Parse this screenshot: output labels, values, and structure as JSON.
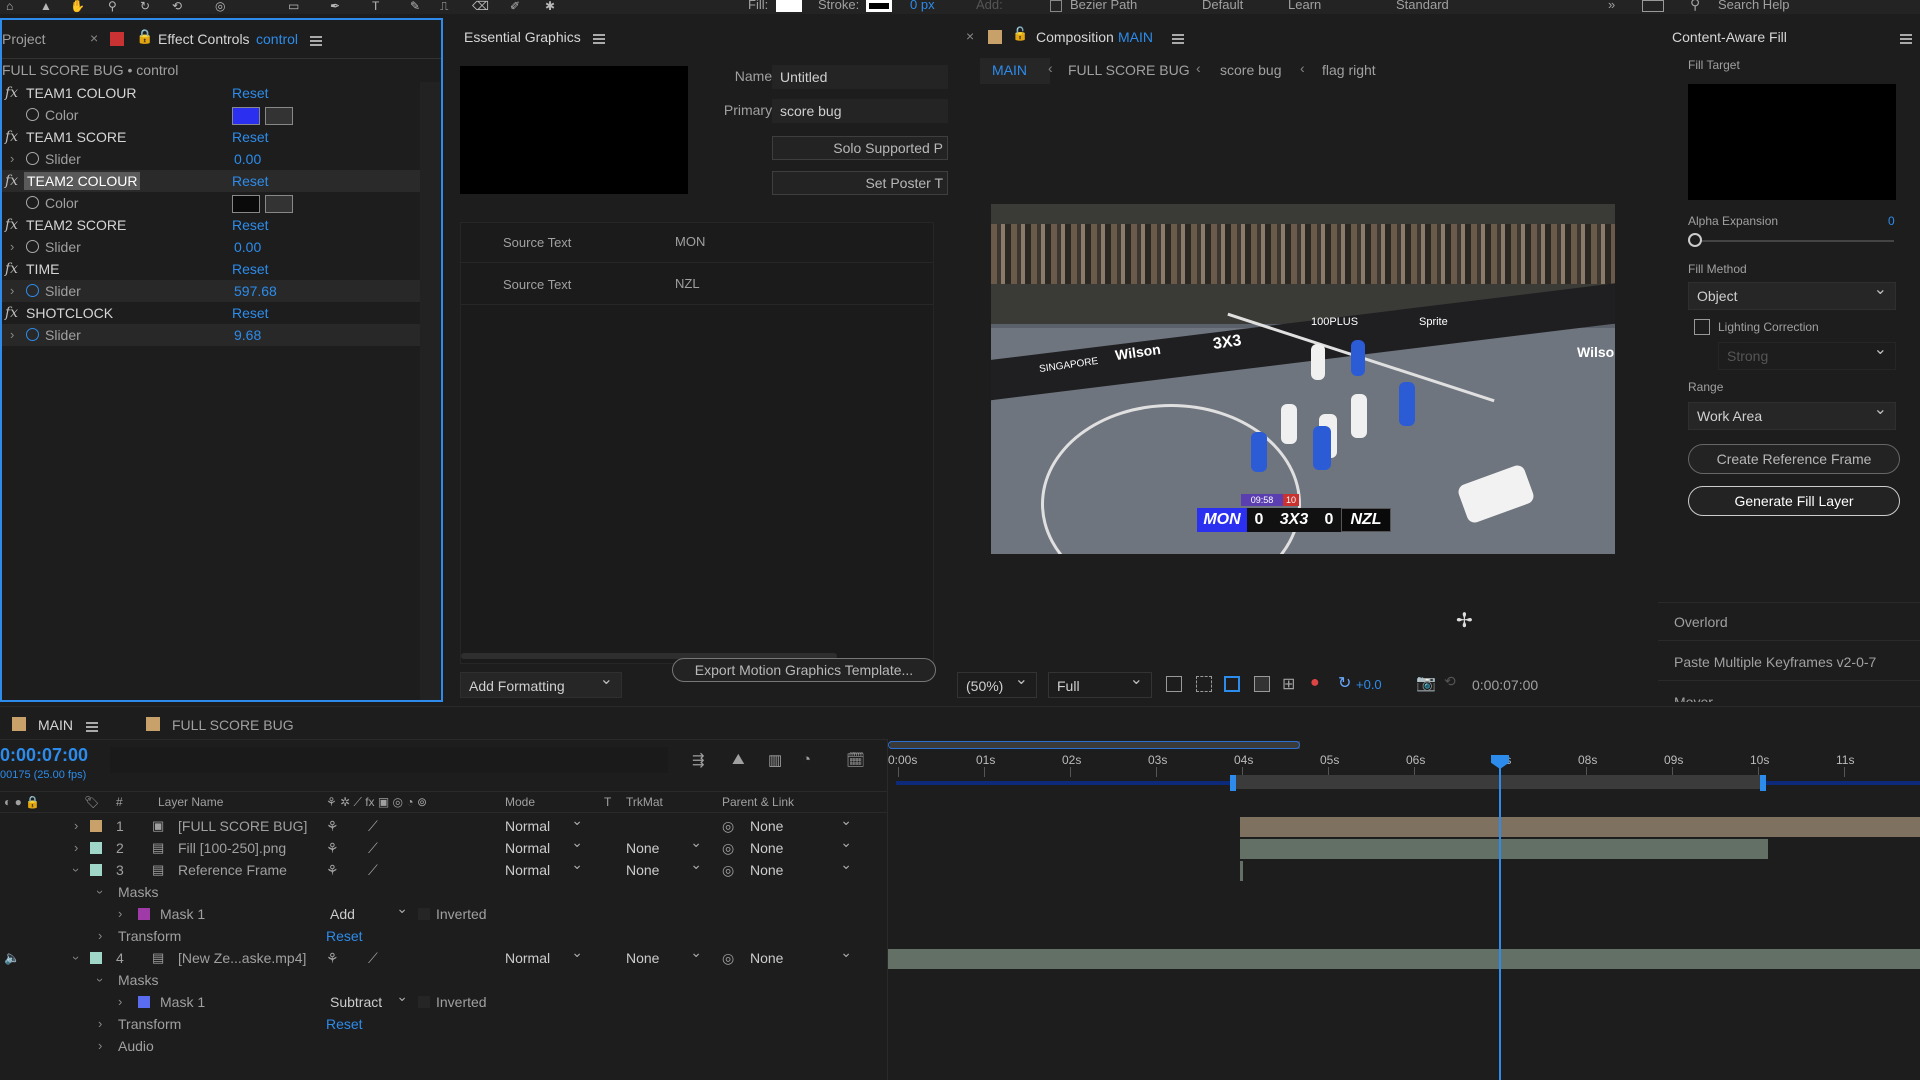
{
  "toolbar": {
    "fill_label": "Fill:",
    "stroke_label": "Stroke:",
    "stroke_px": "0 px",
    "add_label": "Add:",
    "bezier_label": "Bezier Path",
    "workspaces": [
      "Default",
      "Learn",
      "Standard"
    ],
    "search_help": "Search Help"
  },
  "left_panel": {
    "project_tab": "Project",
    "effect_controls_tab": "Effect Controls",
    "effect_controls_target": "control",
    "layer_path": "FULL SCORE BUG • control",
    "effects": [
      {
        "name": "TEAM1 COLOUR",
        "reset": "Reset",
        "prop": "Color",
        "type": "color",
        "color": "#2a2ff0"
      },
      {
        "name": "TEAM1 SCORE",
        "reset": "Reset",
        "prop": "Slider",
        "type": "slider",
        "value": "0.00"
      },
      {
        "name": "TEAM2 COLOUR",
        "reset": "Reset",
        "prop": "Color",
        "type": "color",
        "color": "#0a0a0a"
      },
      {
        "name": "TEAM2 SCORE",
        "reset": "Reset",
        "prop": "Slider",
        "type": "slider",
        "value": "0.00"
      },
      {
        "name": "TIME",
        "reset": "Reset",
        "prop": "Slider",
        "type": "slider",
        "value": "597.68"
      },
      {
        "name": "SHOTCLOCK",
        "reset": "Reset",
        "prop": "Slider",
        "type": "slider",
        "value": "9.68"
      }
    ]
  },
  "essential_graphics": {
    "tab": "Essential Graphics",
    "name_label": "Name:",
    "name_value": "Untitled",
    "primary_label": "Primary:",
    "primary_value": "score bug",
    "solo_button": "Solo Supported P",
    "poster_button": "Set Poster T",
    "properties": [
      {
        "label": "Source Text",
        "value": "MON"
      },
      {
        "label": "Source Text",
        "value": "NZL"
      }
    ],
    "add_formatting": "Add Formatting",
    "export_button": "Export Motion Graphics Template..."
  },
  "composition": {
    "tab_prefix": "Composition",
    "tab_name": "MAIN",
    "breadcrumbs": [
      "MAIN",
      "FULL SCORE BUG",
      "score bug",
      "flag right"
    ],
    "scorebug": {
      "team1": "MON",
      "score1": "0",
      "logo": "3X3",
      "score2": "0",
      "team2": "NZL",
      "clock": "09:58",
      "shotclock": "10"
    },
    "zoom": "(50%)",
    "resolution": "Full",
    "exposure": "+0.0",
    "timecode": "0:00:07:00",
    "ads": [
      "Wilson",
      "3X3",
      "SINGAPORE",
      "100PLUS",
      "Sprite",
      "Wilso"
    ]
  },
  "content_aware_fill": {
    "tab": "Content-Aware Fill",
    "fill_target_label": "Fill Target",
    "alpha_label": "Alpha Expansion",
    "alpha_value": "0",
    "alpha_level": 0,
    "fill_method_label": "Fill Method",
    "fill_method_value": "Object",
    "lighting_label": "Lighting Correction",
    "lighting_checked": false,
    "lighting_strength": "Strong",
    "range_label": "Range",
    "range_value": "Work Area",
    "create_ref_button": "Create Reference Frame",
    "generate_button": "Generate Fill Layer",
    "other_panels": [
      "Overlord",
      "Paste Multiple Keyframes v2-0-7",
      "Mover"
    ]
  },
  "timeline": {
    "tabs": [
      "MAIN",
      "FULL SCORE BUG"
    ],
    "timecode": "0:00:07:00",
    "frame_info": "00175 (25.00 fps)",
    "headers": {
      "num": "#",
      "layer_name": "Layer Name",
      "mode": "Mode",
      "t": "T",
      "trkmat": "TrkMat",
      "parent": "Parent & Link"
    },
    "ruler": [
      "0:00s",
      "01s",
      "02s",
      "03s",
      "04s",
      "05s",
      "06s",
      "07s",
      "08s",
      "09s",
      "10s",
      "11s"
    ],
    "current_time_seconds": 7,
    "layers": [
      {
        "num": "1",
        "name": "[FULL SCORE BUG]",
        "mode": "Normal",
        "trkmat": "",
        "parent": "None",
        "color": "#c8a06a"
      },
      {
        "num": "2",
        "name": "Fill [100-250].png",
        "mode": "Normal",
        "trkmat": "None",
        "parent": "None",
        "color": "#9fd6c8"
      },
      {
        "num": "3",
        "name": "Reference Frame",
        "mode": "Normal",
        "trkmat": "None",
        "parent": "None",
        "color": "#9fd6c8"
      },
      {
        "num": "4",
        "name": "[New Ze...aske.mp4]",
        "mode": "Normal",
        "trkmat": "None",
        "parent": "None",
        "color": "#9fd6c8"
      }
    ],
    "sub_rows": {
      "masks": "Masks",
      "mask1": "Mask 1",
      "mask3_mode": "Add",
      "mask4_mode": "Subtract",
      "inverted": "Inverted",
      "transform": "Transform",
      "reset": "Reset",
      "audio": "Audio"
    }
  }
}
